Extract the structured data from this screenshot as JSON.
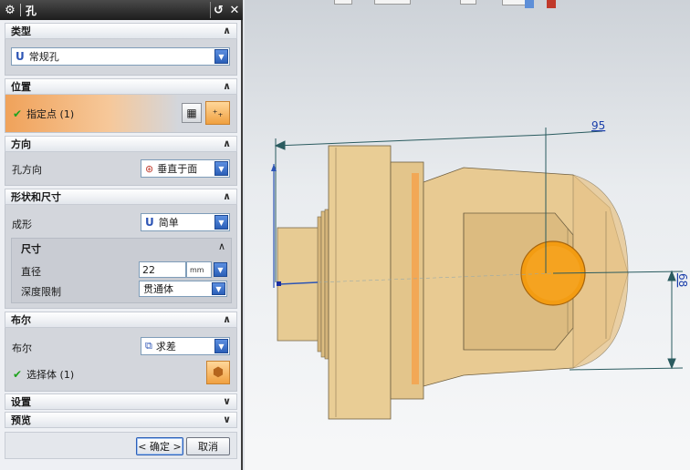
{
  "dialog": {
    "title": "孔",
    "title_icons": {
      "settings": "gear-icon",
      "reset": "reset-icon",
      "close": "close-icon"
    },
    "sections": {
      "type": {
        "header": "类型",
        "selected": "常规孔"
      },
      "position": {
        "header": "位置",
        "specify_point": "指定点 (1)"
      },
      "direction": {
        "header": "方向",
        "label": "孔方向",
        "selected": "垂直于面"
      },
      "shape": {
        "header": "形状和尺寸",
        "form_label": "成形",
        "form_selected": "简单",
        "dimensions": {
          "header": "尺寸",
          "diameter_label": "直径",
          "diameter_value": "22",
          "diameter_unit": "mm",
          "depth_label": "深度限制",
          "depth_selected": "贯通体"
        }
      },
      "boolean": {
        "header": "布尔",
        "label": "布尔",
        "selected": "求差",
        "select_body": "选择体 (1)"
      },
      "settings": {
        "header": "设置"
      },
      "preview": {
        "header": "预览"
      }
    },
    "buttons": {
      "ok": "< 确定 >",
      "cancel": "取消"
    }
  },
  "viewport": {
    "dim_length": "95",
    "dim_height": "68",
    "colors": {
      "part_body": "#e6c890",
      "part_shadow": "#cfae72",
      "hole_preview": "#f39c12",
      "dim_line": "#2a5b5f",
      "dim_label": "#1b3faa"
    }
  }
}
